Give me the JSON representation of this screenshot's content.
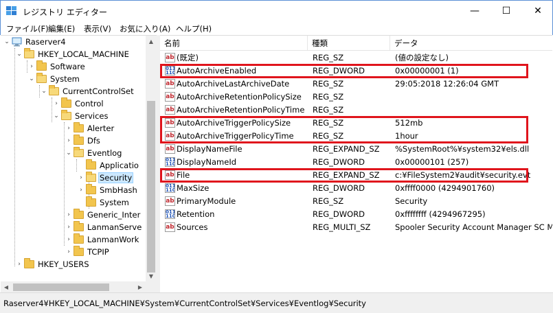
{
  "window": {
    "title": "レジストリ エディター",
    "min_symbol": "—",
    "max_symbol": "☐",
    "close_symbol": "✕"
  },
  "menu": [
    "ファイル(F)",
    "編集(E)",
    "表示(V)",
    "お気に入り(A)",
    "ヘルプ(H)"
  ],
  "tree": {
    "nodes": [
      {
        "label": "Raserver4",
        "expanded": true,
        "icon": "computer-icon"
      },
      {
        "label": "HKEY_LOCAL_MACHINE",
        "expanded": true,
        "icon": "folder-icon"
      },
      {
        "label": "Software",
        "expanded": false,
        "icon": "folder-icon"
      },
      {
        "label": "System",
        "expanded": true,
        "icon": "folder-icon"
      },
      {
        "label": "CurrentControlSet",
        "expanded": true,
        "icon": "folder-icon"
      },
      {
        "label": "Control",
        "expanded": false,
        "icon": "folder-icon"
      },
      {
        "label": "Services",
        "expanded": true,
        "icon": "folder-icon"
      },
      {
        "label": "Alerter",
        "expanded": false,
        "icon": "folder-icon"
      },
      {
        "label": "Dfs",
        "expanded": false,
        "icon": "folder-icon"
      },
      {
        "label": "Eventlog",
        "expanded": true,
        "icon": "folder-icon"
      },
      {
        "label": "Applicatio",
        "expanded": false,
        "icon": "folder-icon"
      },
      {
        "label": "Security",
        "expanded": false,
        "icon": "folder-icon",
        "selected": true
      },
      {
        "label": "SmbHash",
        "expanded": false,
        "icon": "folder-icon"
      },
      {
        "label": "System",
        "expanded": false,
        "icon": "folder-icon"
      },
      {
        "label": "Generic_Inter",
        "expanded": false,
        "icon": "folder-icon"
      },
      {
        "label": "LanmanServe",
        "expanded": false,
        "icon": "folder-icon"
      },
      {
        "label": "LanmanWork",
        "expanded": false,
        "icon": "folder-icon"
      },
      {
        "label": "TCPIP",
        "expanded": false,
        "icon": "folder-icon"
      },
      {
        "label": "HKEY_USERS",
        "expanded": false,
        "icon": "folder-icon"
      }
    ]
  },
  "list": {
    "columns": [
      "名前",
      "種類",
      "データ"
    ],
    "rows": [
      {
        "icon": "ab",
        "name": "(既定)",
        "type": "REG_SZ",
        "data": "(値の設定なし)",
        "highlighted": false
      },
      {
        "icon": "bin",
        "name": "AutoArchiveEnabled",
        "type": "REG_DWORD",
        "data": "0x00000001 (1)",
        "highlighted": true
      },
      {
        "icon": "ab",
        "name": "AutoArchiveLastArchiveDate",
        "type": "REG_SZ",
        "data": "29:05:2018 12:26:04 GMT",
        "highlighted": false
      },
      {
        "icon": "ab",
        "name": "AutoArchiveRetentionPolicySize",
        "type": "REG_SZ",
        "data": "",
        "highlighted": false
      },
      {
        "icon": "ab",
        "name": "AutoArchiveRetentionPolicyTime",
        "type": "REG_SZ",
        "data": "",
        "highlighted": false
      },
      {
        "icon": "ab",
        "name": "AutoArchiveTriggerPolicySize",
        "type": "REG_SZ",
        "data": "512mb",
        "highlighted": true
      },
      {
        "icon": "ab",
        "name": "AutoArchiveTriggerPolicyTime",
        "type": "REG_SZ",
        "data": "1hour",
        "highlighted": true
      },
      {
        "icon": "ab",
        "name": "DisplayNameFile",
        "type": "REG_EXPAND_SZ",
        "data": "%SystemRoot%¥system32¥els.dll",
        "highlighted": false
      },
      {
        "icon": "bin",
        "name": "DisplayNameId",
        "type": "REG_DWORD",
        "data": "0x00000101 (257)",
        "highlighted": false
      },
      {
        "icon": "ab",
        "name": "File",
        "type": "REG_EXPAND_SZ",
        "data": "c:¥FileSystem2¥audit¥security.evt",
        "highlighted": true
      },
      {
        "icon": "bin",
        "name": "MaxSize",
        "type": "REG_DWORD",
        "data": "0xffff0000 (4294901760)",
        "highlighted": false
      },
      {
        "icon": "ab",
        "name": "PrimaryModule",
        "type": "REG_SZ",
        "data": "Security",
        "highlighted": false
      },
      {
        "icon": "bin",
        "name": "Retention",
        "type": "REG_DWORD",
        "data": "0xffffffff (4294967295)",
        "highlighted": false
      },
      {
        "icon": "ab",
        "name": "Sources",
        "type": "REG_MULTI_SZ",
        "data": "Spooler Security Account Manager SC Man",
        "highlighted": false
      }
    ]
  },
  "status": {
    "path": "Raserver4¥HKEY_LOCAL_MACHINE¥System¥CurrentControlSet¥Services¥Eventlog¥Security"
  },
  "colors": {
    "highlight": "#e0141c",
    "selection": "#cce8ff",
    "folder": "#f2c54e",
    "window_border": "#5a8fd6"
  }
}
